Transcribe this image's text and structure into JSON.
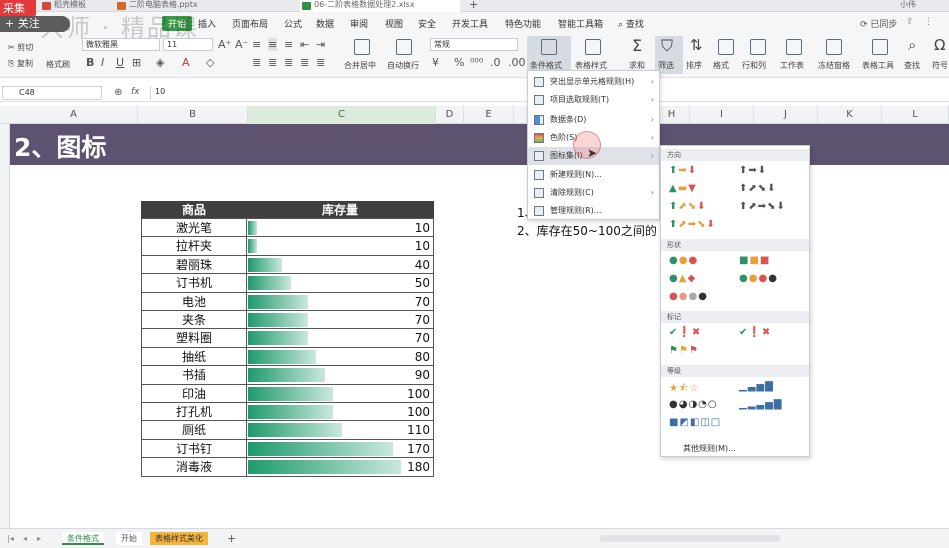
{
  "overlay": {
    "caiji": "采集",
    "guanzhu": "+ 关注",
    "watermark": "大师 · 精品课"
  },
  "doc_tabs": [
    {
      "label": "稻壳模板",
      "color": "#d24b3a"
    },
    {
      "label": "二阶电脑表格.pptx",
      "color": "#d2692a"
    },
    {
      "label": "06-二阶表格数据处理2.xlsx",
      "color": "#2f8f46"
    }
  ],
  "menu": {
    "start": "开始",
    "items": [
      "插入",
      "页面布局",
      "公式",
      "数据",
      "审阅",
      "视图",
      "安全",
      "开发工具",
      "特色功能",
      "智能工具箱"
    ],
    "search": "查找",
    "sync": "已同步",
    "user": "小伟"
  },
  "ribbon": {
    "cut": "剪切",
    "copy": "复制",
    "format_painter": "格式刷",
    "font_name": "微软雅黑",
    "font_size": "11",
    "merge": "合并居中",
    "wrap": "自动换行",
    "number_format": "常规",
    "conditional_format": "条件格式",
    "table_style": "表格样式",
    "sum": "求和",
    "filter": "筛选",
    "sort": "排序",
    "format": "格式",
    "row_col": "行和列",
    "worksheet": "工作表",
    "freeze": "冻结窗格",
    "table_tools": "表格工具",
    "find": "查找",
    "symbol": "符号"
  },
  "formula_bar": {
    "cell": "C48",
    "value": "10"
  },
  "columns": [
    "A",
    "B",
    "C",
    "D",
    "E",
    "F",
    "G",
    "H",
    "I",
    "J",
    "K",
    "L"
  ],
  "sheet": {
    "title": "2、图标",
    "header": {
      "product": "商品",
      "stock": "库存量"
    },
    "rows": [
      {
        "product": "激光笔",
        "stock": 10
      },
      {
        "product": "拉杆夹",
        "stock": 10
      },
      {
        "product": "碧丽珠",
        "stock": 40
      },
      {
        "product": "订书机",
        "stock": 50
      },
      {
        "product": "电池",
        "stock": 70
      },
      {
        "product": "夹条",
        "stock": 70
      },
      {
        "product": "塑料圈",
        "stock": 70
      },
      {
        "product": "抽纸",
        "stock": 80
      },
      {
        "product": "书插",
        "stock": 90
      },
      {
        "product": "印油",
        "stock": 100
      },
      {
        "product": "打孔机",
        "stock": 100
      },
      {
        "product": "厕纸",
        "stock": 110
      },
      {
        "product": "订书钉",
        "stock": 170
      },
      {
        "product": "消毒液",
        "stock": 180
      }
    ],
    "max_stock": 180,
    "notes": [
      "1、",
      "2、库存在50~100之间的"
    ]
  },
  "dropdown": {
    "items": [
      {
        "label": "突出显示单元格规则(H)",
        "arrow": "›"
      },
      {
        "label": "项目选取规则(T)",
        "arrow": "›"
      },
      {
        "label": "数据条(D)",
        "arrow": "›"
      },
      {
        "label": "色阶(S)",
        "arrow": "›"
      },
      {
        "label": "图标集(I)",
        "arrow": "›"
      },
      {
        "label": "新建规则(N)...",
        "arrow": ""
      },
      {
        "label": "清除规则(C)",
        "arrow": "›"
      },
      {
        "label": "管理规则(R)...",
        "arrow": ""
      }
    ]
  },
  "submenu": {
    "sections": [
      "方向",
      "形状",
      "标记",
      "等级"
    ],
    "more": "其他规则(M)..."
  },
  "sheet_tabs": [
    "条件格式",
    "开始",
    "表格样式美化"
  ]
}
